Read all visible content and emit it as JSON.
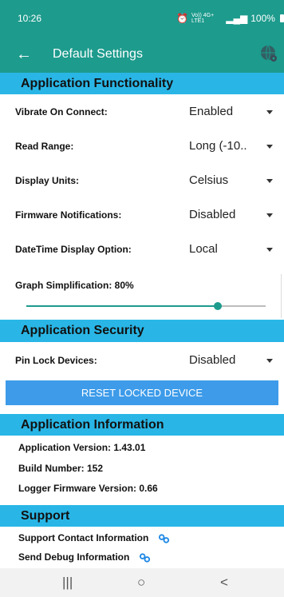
{
  "status_bar": {
    "time": "10:26",
    "signal_text": "Vo)) 4G+ LTE1",
    "battery": "100%"
  },
  "toolbar": {
    "title": "Default Settings",
    "back_icon": "arrow-left-icon",
    "globe_icon": "globe-gear-icon"
  },
  "sections": {
    "functionality": "Application Functionality",
    "security": "Application Security",
    "information": "Application Information",
    "support": "Support"
  },
  "settings": [
    {
      "label": "Vibrate On Connect:",
      "value": "Enabled"
    },
    {
      "label": "Read Range:",
      "value": "Long (-10.."
    },
    {
      "label": "Display Units:",
      "value": "Celsius"
    },
    {
      "label": "Firmware Notifications:",
      "value": "Disabled"
    },
    {
      "label": "DateTime Display Option:",
      "value": "Local"
    }
  ],
  "graph": {
    "label": "Graph Simplification: 80%",
    "level": 0.8
  },
  "security": {
    "label": "Pin Lock Devices:",
    "value": "Disabled",
    "reset_button": "RESET LOCKED DEVICE"
  },
  "info": {
    "version": "Application Version: 1.43.01",
    "build": "Build Number: 152",
    "firmware": "Logger Firmware Version: 0.66"
  },
  "support": {
    "contact": "Support Contact Information",
    "debug": "Send Debug Information"
  },
  "colors": {
    "primary": "#1d9b8d",
    "section": "#29b6e6",
    "button": "#3d9be9"
  },
  "nav": {
    "recent": "|||",
    "home": "○",
    "back": "<"
  }
}
